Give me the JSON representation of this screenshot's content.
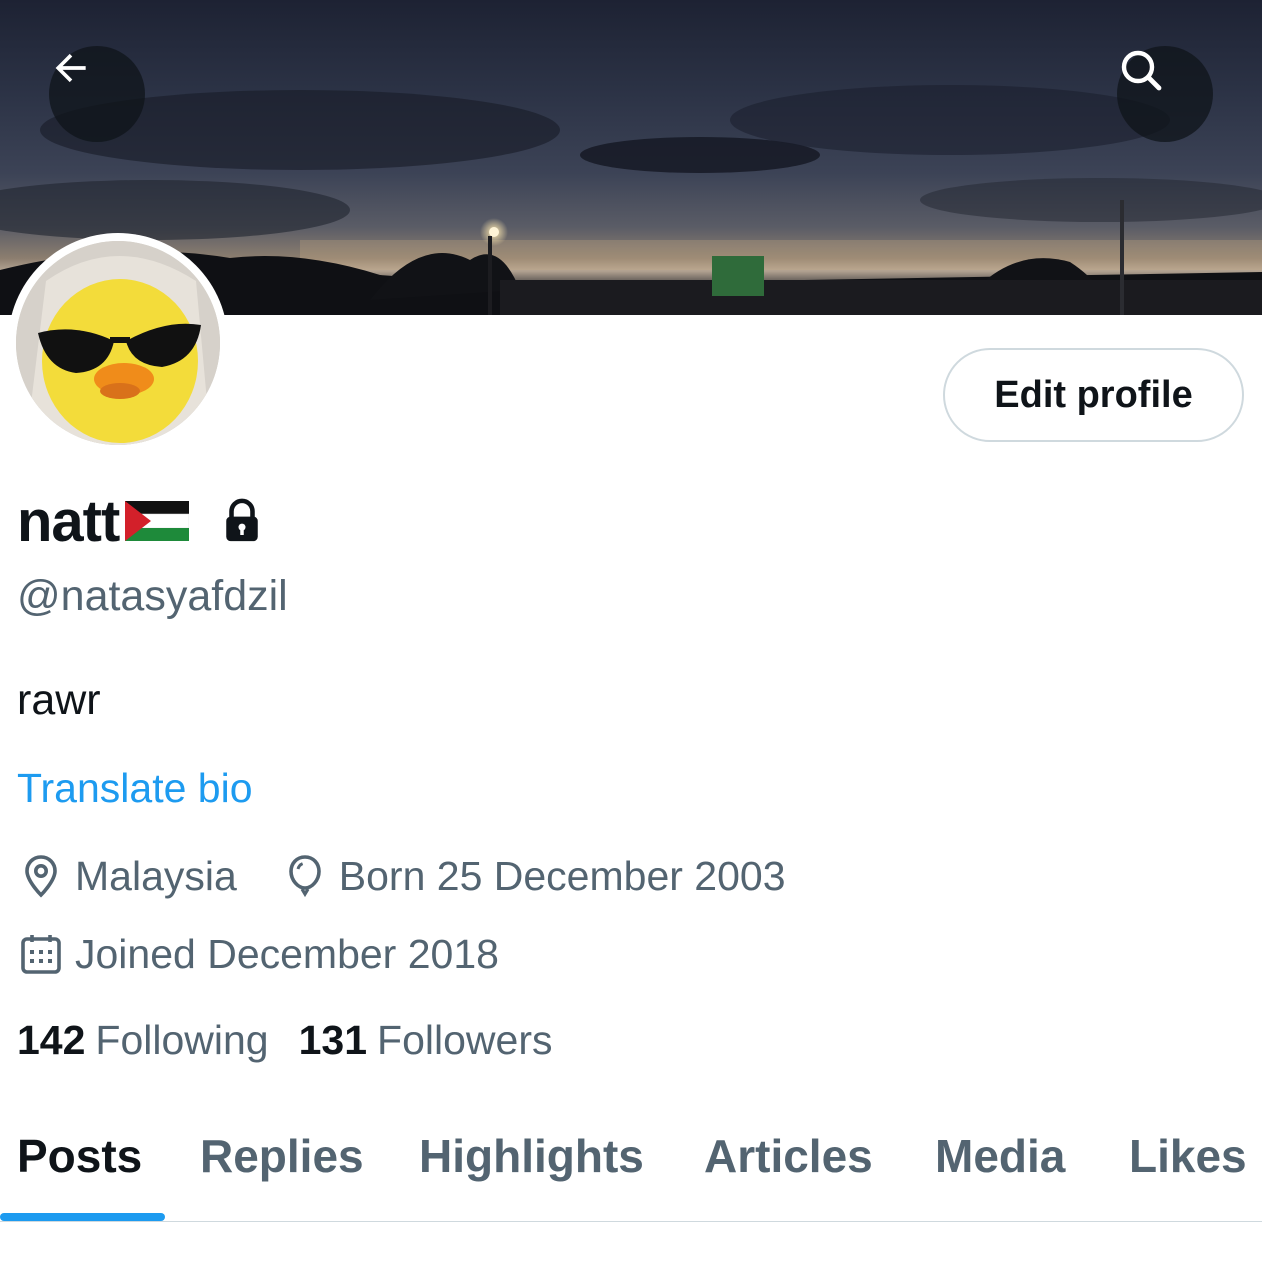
{
  "header": {
    "back_icon": "arrow-left-icon",
    "search_icon": "search-icon"
  },
  "profile": {
    "name": "natt",
    "name_flag_icon": "palestine-flag-icon",
    "protected_icon": "lock-icon",
    "handle": "@natasyafdzil",
    "bio": "rawr",
    "translate_label": "Translate bio",
    "edit_label": "Edit profile",
    "location": "Malaysia",
    "birthday": "Born 25 December 2003",
    "joined": "Joined December 2018",
    "following_count": "142",
    "following_label": "Following",
    "followers_count": "131",
    "followers_label": "Followers"
  },
  "tabs": [
    {
      "label": "Posts",
      "active": true
    },
    {
      "label": "Replies",
      "active": false
    },
    {
      "label": "Highlights",
      "active": false
    },
    {
      "label": "Articles",
      "active": false
    },
    {
      "label": "Media",
      "active": false
    },
    {
      "label": "Likes",
      "active": false
    }
  ],
  "colors": {
    "accent": "#1d9bf0",
    "text_primary": "#0f1419",
    "text_secondary": "#536471",
    "border": "#cfd9de"
  }
}
